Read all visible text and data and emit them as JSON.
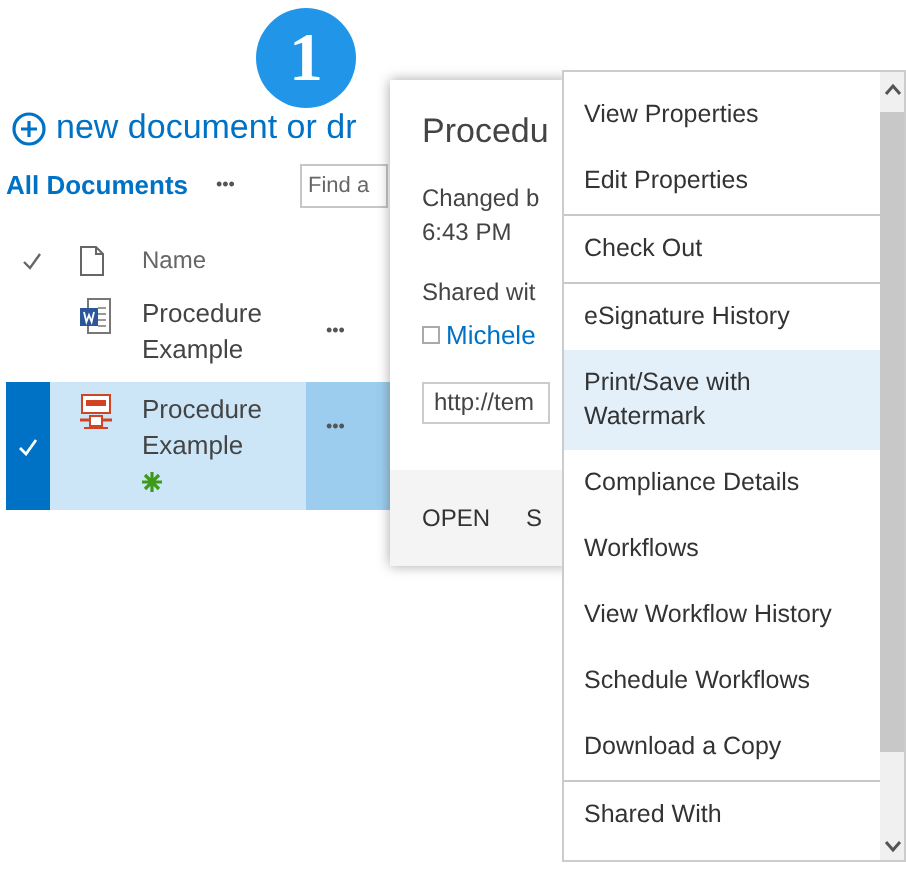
{
  "badge": {
    "text": "1"
  },
  "new_link": {
    "text": "new document or dr"
  },
  "view": {
    "label": "All Documents",
    "more": "•••",
    "search_placeholder": "Find a"
  },
  "columns": [
    {
      "label": "Name"
    }
  ],
  "rows": [
    {
      "name": "Procedure Example",
      "kind": "word",
      "selected": false,
      "new": false,
      "more": "•••"
    },
    {
      "name": "Procedure Example",
      "kind": "pdf",
      "selected": true,
      "new": true,
      "more": "•••"
    }
  ],
  "callout": {
    "title": "Procedu",
    "changed": "Changed b",
    "time": "6:43 PM",
    "shared_label": "Shared wit",
    "person": "Michele",
    "person_checked": false,
    "url": "http://tem",
    "actions": [
      "OPEN",
      "S"
    ]
  },
  "menu": {
    "groups": [
      [
        {
          "label": "View Properties",
          "selected": false
        },
        {
          "label": "Edit Properties",
          "selected": false
        }
      ],
      [
        {
          "label": "Check Out",
          "selected": false
        }
      ],
      [
        {
          "label": "eSignature History",
          "selected": false
        },
        {
          "label": "Print/Save with Watermark",
          "selected": true
        },
        {
          "label": "Compliance Details",
          "selected": false
        },
        {
          "label": "Workflows",
          "selected": false
        },
        {
          "label": "View Workflow History",
          "selected": false
        },
        {
          "label": "Schedule Workflows",
          "selected": false
        },
        {
          "label": "Download a Copy",
          "selected": false
        }
      ],
      [
        {
          "label": "Shared With",
          "selected": false
        }
      ]
    ]
  }
}
